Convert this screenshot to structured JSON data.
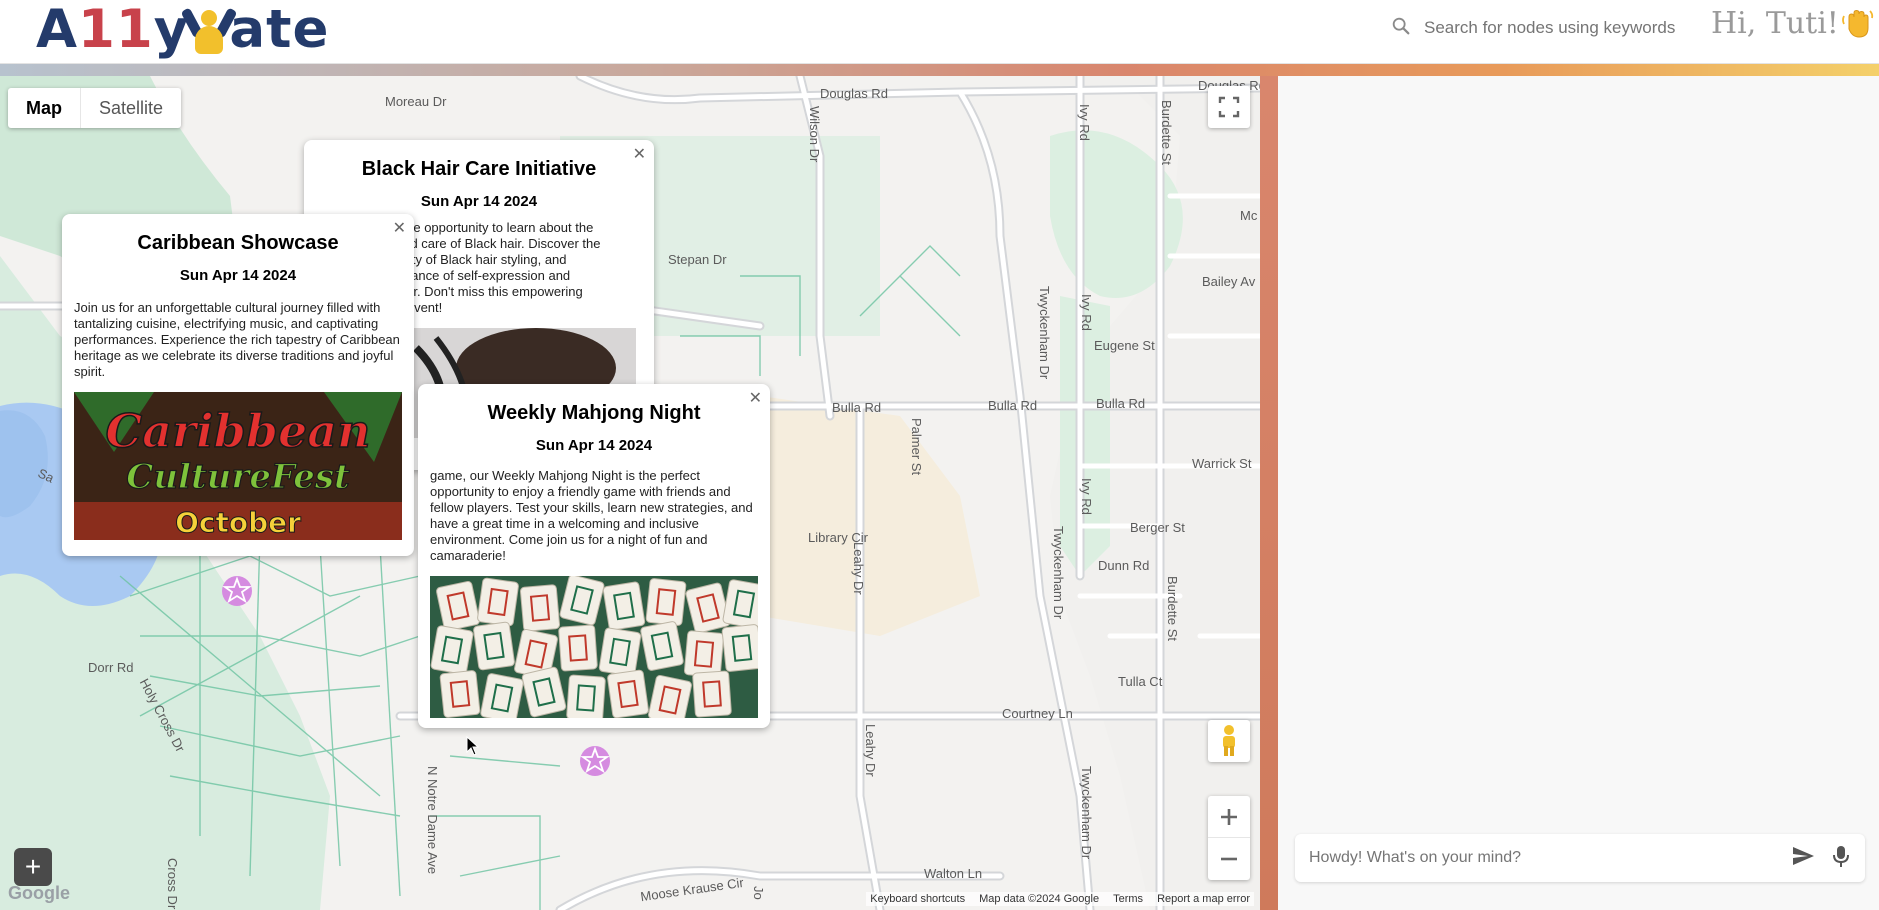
{
  "header": {
    "logo": {
      "a": "A",
      "ones": "11",
      "y": "y",
      "rest": "ate"
    },
    "search": {
      "placeholder": "Search for nodes using keywords"
    },
    "greeting": "Hi, Tuti!"
  },
  "map": {
    "type_controls": {
      "map": "Map",
      "satellite": "Satellite"
    },
    "road_labels": {
      "moreau": "Moreau Dr",
      "douglas": "Douglas Rd",
      "douglas2": "Douglas Rd",
      "wilson": "Wilson Dr",
      "ivy": "Ivy Rd",
      "burdette": "Burdette St",
      "mc": "Mc",
      "bailey": "Bailey Av",
      "stepan": "Stepan Dr",
      "eugene": "Eugene St",
      "twyckenham": "Twyckenham Dr",
      "ivy2": "Ivy Rd",
      "bulla": "Bulla Rd",
      "bulla2": "Bulla Rd",
      "bulla3": "Bulla Rd",
      "palmer": "Palmer St",
      "warrick": "Warrick St",
      "ivy3": "Ivy Rd",
      "library": "Library Cir",
      "berger": "Berger St",
      "twyck2": "Twyckenham Dr",
      "leahy": "Leahy Dr",
      "dunn": "Dunn Rd",
      "burdette2": "Burdette St",
      "tulla": "Tulla Ct",
      "dorr": "Dorr Rd",
      "holycross": "Holy Cross Dr",
      "courtney": "Courtney Ln",
      "leahy2": "Leahy Dr",
      "ndame": "N Notre Dame Ave",
      "twyck3": "Twyckenham Dr",
      "walton": "Walton Ln",
      "moose": "Moose Krause Cir",
      "cross": "Cross Dr",
      "jo": "Jo",
      "sa": "Sa"
    },
    "footer": {
      "shortcuts": "Keyboard shortcuts",
      "mapdata": "Map data ©2024 Google",
      "terms": "Terms",
      "report": "Report a map error"
    },
    "google": "Google",
    "add_button": "+"
  },
  "popups": {
    "black_hair": {
      "title": "Black Hair Care Initiative",
      "date": "Sun Apr 14 2024",
      "desc_partial": "ique opportunity to learn about the\nand care of Black hair. Discover the\ntivity of Black hair styling, and\nortance of self-expression and\nhair. Don't miss this empowering\ng event!"
    },
    "caribbean": {
      "title": "Caribbean Showcase",
      "date": "Sun Apr 14 2024",
      "desc": "Join us for an unforgettable cultural journey filled with tantalizing cuisine, electrifying music, and captivating performances. Experience the rich tapestry of Caribbean heritage as we celebrate its diverse traditions and joyful spirit.",
      "image_title1": "Caribbean",
      "image_title2": "CultureFest",
      "image_month": "October"
    },
    "mahjong": {
      "title": "Weekly Mahjong Night",
      "date": "Sun Apr 14 2024",
      "desc_partial": "game, our Weekly Mahjong Night is the perfect opportunity to enjoy a friendly game with friends and fellow players. Test your skills, learn new strategies, and have a great time in a welcoming and inclusive environment. Come join us for a night of fun and camaraderie!"
    }
  },
  "chat": {
    "placeholder": "Howdy! What's on your mind?"
  },
  "colors": {
    "logo_navy": "#243b6b",
    "logo_red": "#c8424b",
    "logo_yellow": "#f2c02c",
    "marker": "#d58be0",
    "panel_edge": "#d9866d"
  },
  "icons": [
    "search-icon",
    "wave-emoji-icon",
    "fullscreen-icon",
    "pegman-icon",
    "zoom-in-icon",
    "zoom-out-icon",
    "close-icon",
    "star-marker-icon",
    "send-icon",
    "mic-icon"
  ]
}
